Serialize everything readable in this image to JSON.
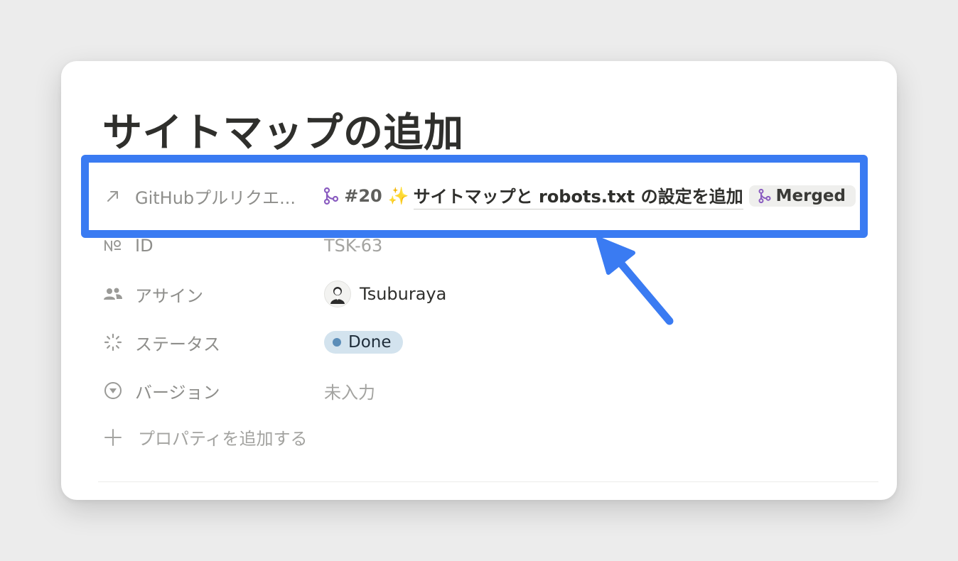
{
  "page": {
    "title": "サイトマップの追加"
  },
  "properties": {
    "github_pr": {
      "label": "GitHubプルリクエ...",
      "icon": "arrow-up-right-icon",
      "pr_number": "#20",
      "pr_emoji": "✨",
      "pr_title": "サイトマップと robots.txt の設定を追加",
      "status_label": "Merged",
      "pr_icon_color": "#8a5cc0"
    },
    "id": {
      "label": "ID",
      "icon": "numero-icon",
      "value": "TSK-63"
    },
    "assignee": {
      "label": "アサイン",
      "icon": "people-icon",
      "name": "Tsuburaya"
    },
    "status": {
      "label": "ステータス",
      "icon": "status-spinner-icon",
      "value": "Done",
      "dot_color": "#5b8db8",
      "pill_color": "#d3e3ee"
    },
    "version": {
      "label": "バージョン",
      "icon": "select-circle-icon",
      "value": "未入力"
    }
  },
  "add_property": {
    "label": "プロパティを追加する",
    "icon": "plus-icon"
  },
  "annotation": {
    "highlight_color": "#3a7bf2"
  }
}
